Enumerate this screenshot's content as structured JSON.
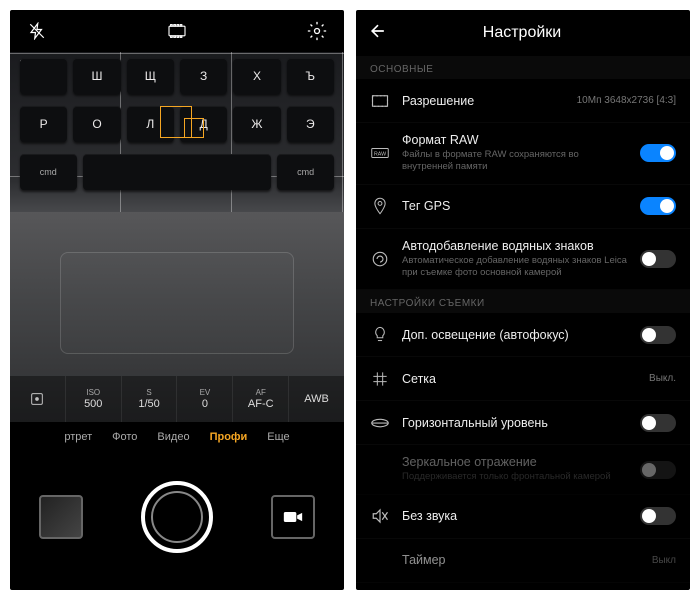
{
  "left": {
    "raw_badge": "RAW",
    "keys": {
      "row1": [
        "",
        "Ш",
        "Щ",
        "З",
        "Х",
        "Ъ"
      ],
      "row2_cmd": "cmd",
      "row2_keys": [
        "Р",
        "О",
        "Л",
        "Д",
        "Ж",
        "Э"
      ]
    },
    "params": {
      "metering": {
        "label": "",
        "value": ""
      },
      "iso": {
        "label": "ISO",
        "value": "500"
      },
      "shutter": {
        "label": "S",
        "value": "1/50"
      },
      "ev": {
        "label": "EV",
        "value": "0"
      },
      "af": {
        "label": "AF",
        "value": "AF-C"
      },
      "wb": {
        "label": "",
        "value": "AWB"
      }
    },
    "modes": {
      "portrait": "ртрет",
      "photo": "Фото",
      "video": "Видео",
      "pro": "Профи",
      "more": "Еще"
    }
  },
  "right": {
    "title": "Настройки",
    "section_main": "ОСНОВНЫЕ",
    "section_shoot": "НАСТРОЙКИ СЪЕМКИ",
    "rows": {
      "resolution": {
        "title": "Разрешение",
        "value": "10Мп 3648x2736 [4:3]"
      },
      "raw": {
        "title": "Формат RAW",
        "desc": "Файлы в формате RAW сохраняются во внутренней памяти",
        "on": true
      },
      "gps": {
        "title": "Тег GPS",
        "on": true
      },
      "watermark": {
        "title": "Автодобавление водяных знаков",
        "desc": "Автоматическое добавление водяных знаков Leica при съемке фото основной камерой",
        "on": false
      },
      "light": {
        "title": "Доп. освещение (автофокус)",
        "on": false
      },
      "grid": {
        "title": "Сетка",
        "value": "Выкл."
      },
      "level": {
        "title": "Горизонтальный уровень",
        "on": false
      },
      "mirror": {
        "title": "Зеркальное отражение",
        "desc": "Поддерживается только фронтальной камерой",
        "on": false
      },
      "mute": {
        "title": "Без звука",
        "on": false
      },
      "timer": {
        "title": "Таймер",
        "value": "Выкл"
      }
    }
  }
}
